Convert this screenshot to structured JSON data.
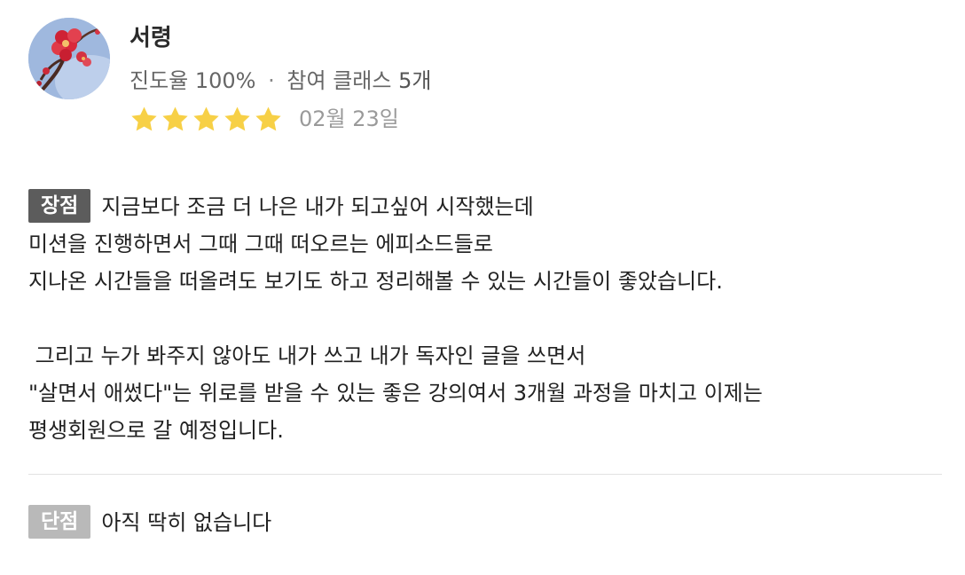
{
  "reviewer": {
    "name": "서령",
    "progress_text": "진도율 100%",
    "separator": "·",
    "classes_label": "참여 클래스",
    "classes_count": "5개",
    "rating": 5,
    "rating_max": 5,
    "date": "02월 23일"
  },
  "pros": {
    "tag": "장점",
    "line1": "지금보다 조금 더 나은 내가 되고싶어 시작했는데",
    "line2": "미션을 진행하면서 그때 그때 떠오르는 에피소드들로",
    "line3": "지나온 시간들을 떠올려도 보기도 하고 정리해볼 수 있는 시간들이 좋았습니다.",
    "line4": " 그리고 누가 봐주지 않아도 내가 쓰고 내가 독자인 글을 쓰면서",
    "line5": "\"살면서 애썼다\"는 위로를 받을 수 있는 좋은 강의여서 3개월 과정을 마치고 이제는",
    "line6": "평생회원으로 갈 예정입니다."
  },
  "cons": {
    "tag": "단점",
    "line1": "아직 딱히 없습니다"
  },
  "colors": {
    "star": "#f7d046",
    "pros_tag_bg": "#5c5c5c",
    "cons_tag_bg": "#b9b9b9",
    "divider": "#e2e2e2"
  },
  "icons": {
    "star": "star-icon",
    "avatar": "plum-blossom-photo"
  }
}
